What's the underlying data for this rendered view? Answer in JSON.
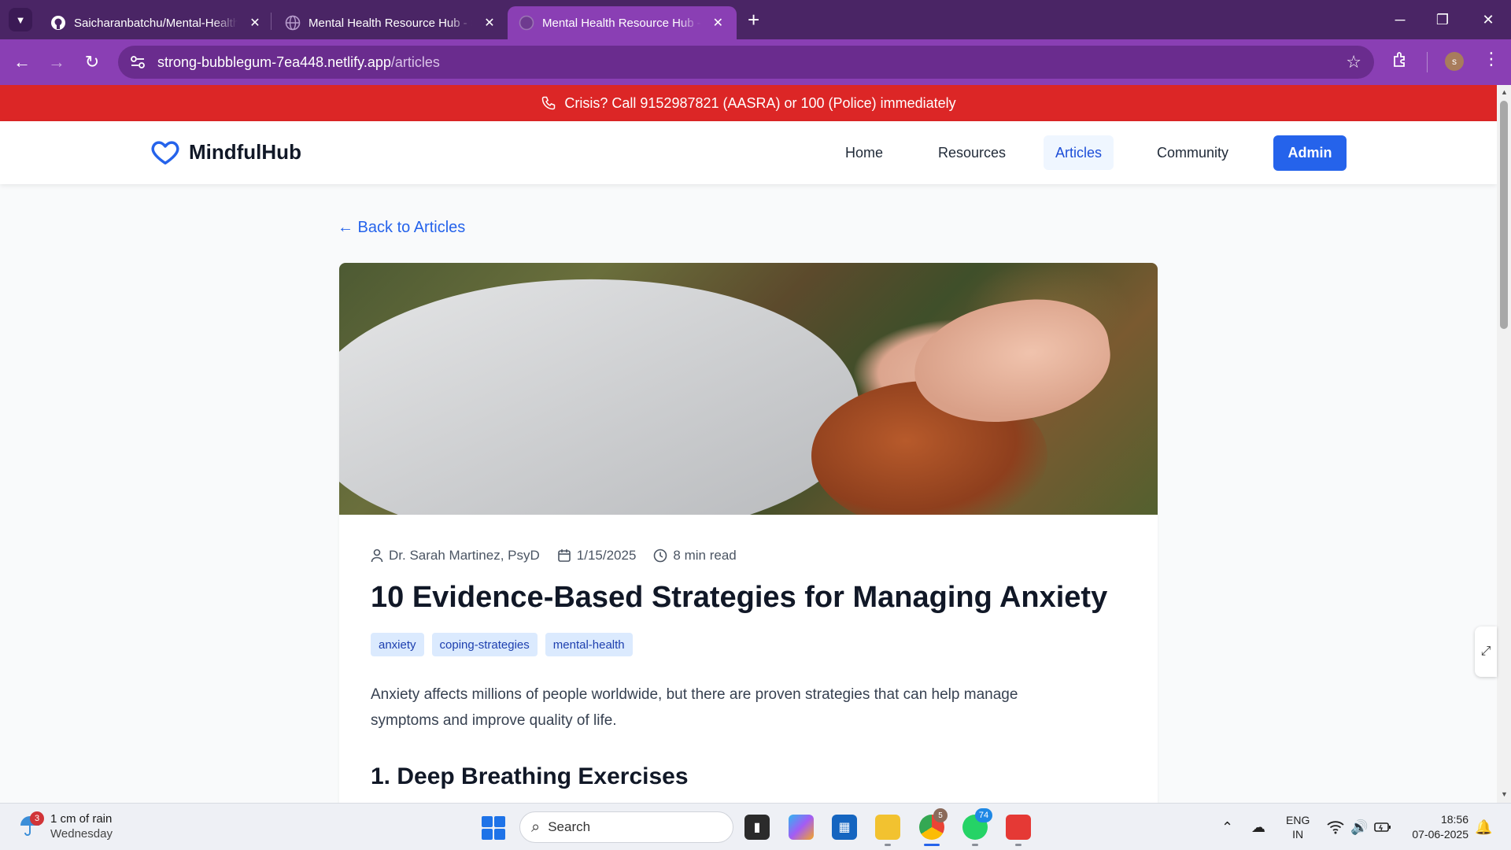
{
  "browser": {
    "tabs": [
      {
        "title": "Saicharanbatchu/Mental-Health-Resource-Hub",
        "active": false
      },
      {
        "title": "Mental Health Resource Hub - Support & Resources",
        "active": false
      },
      {
        "title": "Mental Health Resource Hub - Support & Resources",
        "active": true
      }
    ],
    "url_domain": "strong-bubblegum-7ea448.netlify.app",
    "url_path": "/articles",
    "profile_initial": "s",
    "accent_color": "#8a3fb4"
  },
  "crisis_banner": {
    "text": "Crisis? Call 9152987821 (AASRA) or 100 (Police) immediately",
    "color": "#dc2626"
  },
  "site": {
    "logo": "MindfulHub",
    "nav": [
      {
        "label": "Home",
        "active": false
      },
      {
        "label": "Resources",
        "active": false
      },
      {
        "label": "Articles",
        "active": true
      },
      {
        "label": "Community",
        "active": false
      }
    ],
    "admin_label": "Admin",
    "primary_color": "#2563eb"
  },
  "article": {
    "back_link": "← Back to Articles",
    "author": "Dr. Sarah Martinez, PsyD",
    "date": "1/15/2025",
    "read_time": "8 min read",
    "title": "10 Evidence-Based Strategies for Managing Anxiety",
    "tags": [
      "anxiety",
      "coping-strategies",
      "mental-health"
    ],
    "intro": "Anxiety affects millions of people worldwide, but there are proven strategies that can help manage symptoms and improve quality of life.",
    "first_heading": "1. Deep Breathing Exercises"
  },
  "taskbar": {
    "weather_badge": "3",
    "weather_main": "1 cm of rain",
    "weather_sub": "Wednesday",
    "search_placeholder": "Search",
    "chrome_badge": "5",
    "whatsapp_badge": "74",
    "lang_top": "ENG",
    "lang_bottom": "IN",
    "time": "18:56",
    "date": "07-06-2025"
  }
}
